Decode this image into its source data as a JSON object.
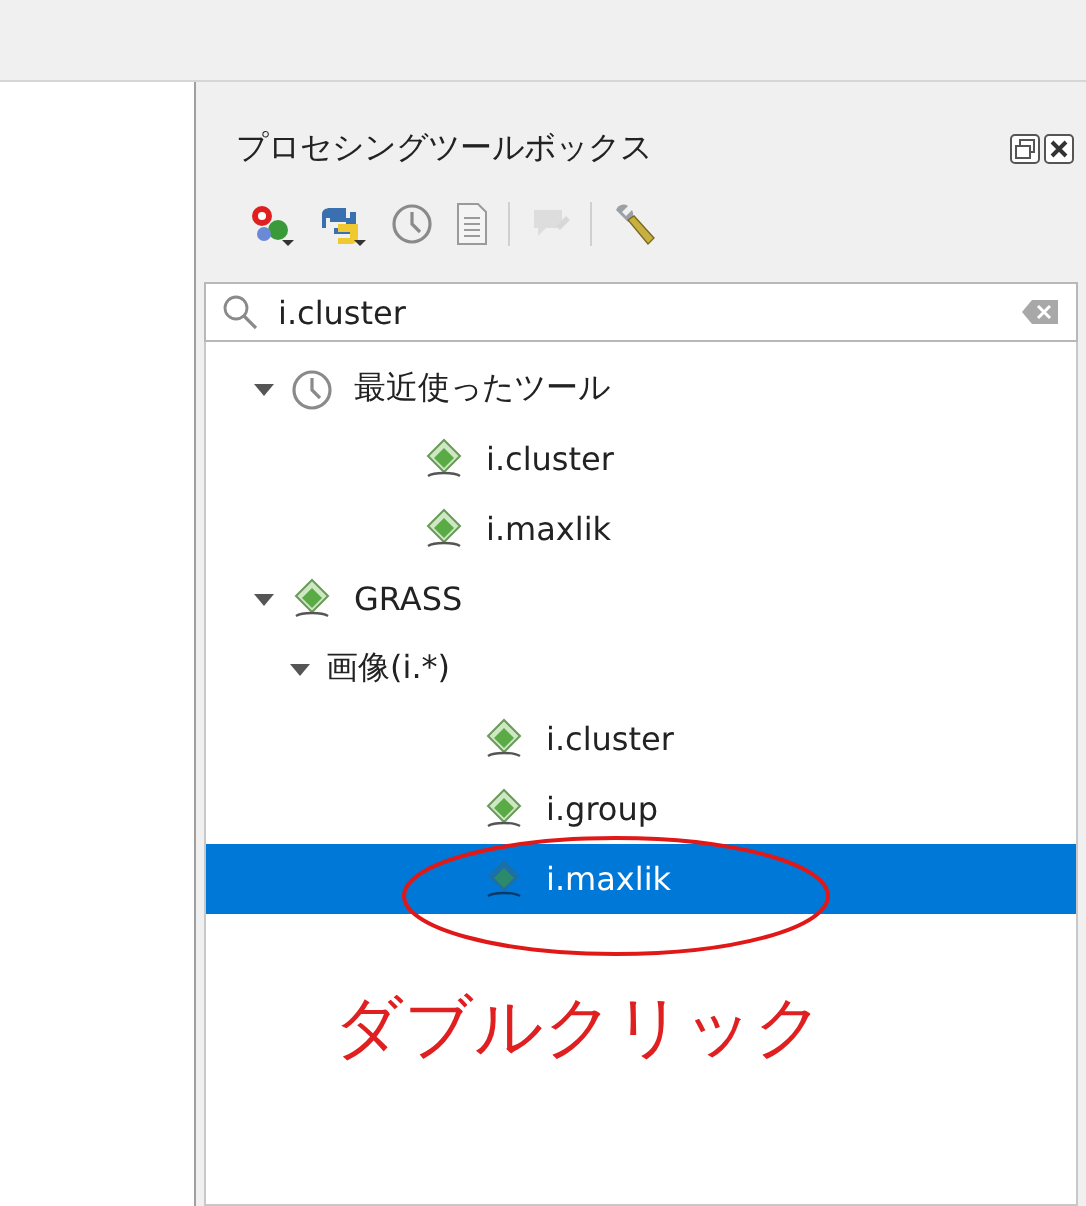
{
  "panel": {
    "title": "プロセシングツールボックス"
  },
  "toolbar": [
    {
      "kind": "models",
      "disabled": false
    },
    {
      "kind": "python",
      "disabled": false
    },
    {
      "kind": "history",
      "disabled": false
    },
    {
      "kind": "results",
      "disabled": false
    },
    {
      "kind": "separator"
    },
    {
      "kind": "edit",
      "disabled": true
    },
    {
      "kind": "separator"
    },
    {
      "kind": "options",
      "disabled": false
    }
  ],
  "search": {
    "value": "i.cluster"
  },
  "tree": [
    {
      "label": "最近使ったツール",
      "kind": "recent",
      "expanded": true,
      "selected": false,
      "children": [
        {
          "label": "i.cluster",
          "kind": "algorithm",
          "selected": false
        },
        {
          "label": "i.maxlik",
          "kind": "algorithm",
          "selected": false
        }
      ]
    },
    {
      "label": "GRASS",
      "kind": "provider",
      "expanded": true,
      "selected": false,
      "children": [
        {
          "label": "画像(i.*)",
          "kind": "group",
          "expanded": true,
          "selected": false,
          "children": [
            {
              "label": "i.cluster",
              "kind": "algorithm",
              "selected": false
            },
            {
              "label": "i.group",
              "kind": "algorithm",
              "selected": false
            },
            {
              "label": "i.maxlik",
              "kind": "algorithm",
              "selected": true
            }
          ]
        }
      ]
    }
  ],
  "annotation": {
    "text": "ダブルクリック"
  }
}
